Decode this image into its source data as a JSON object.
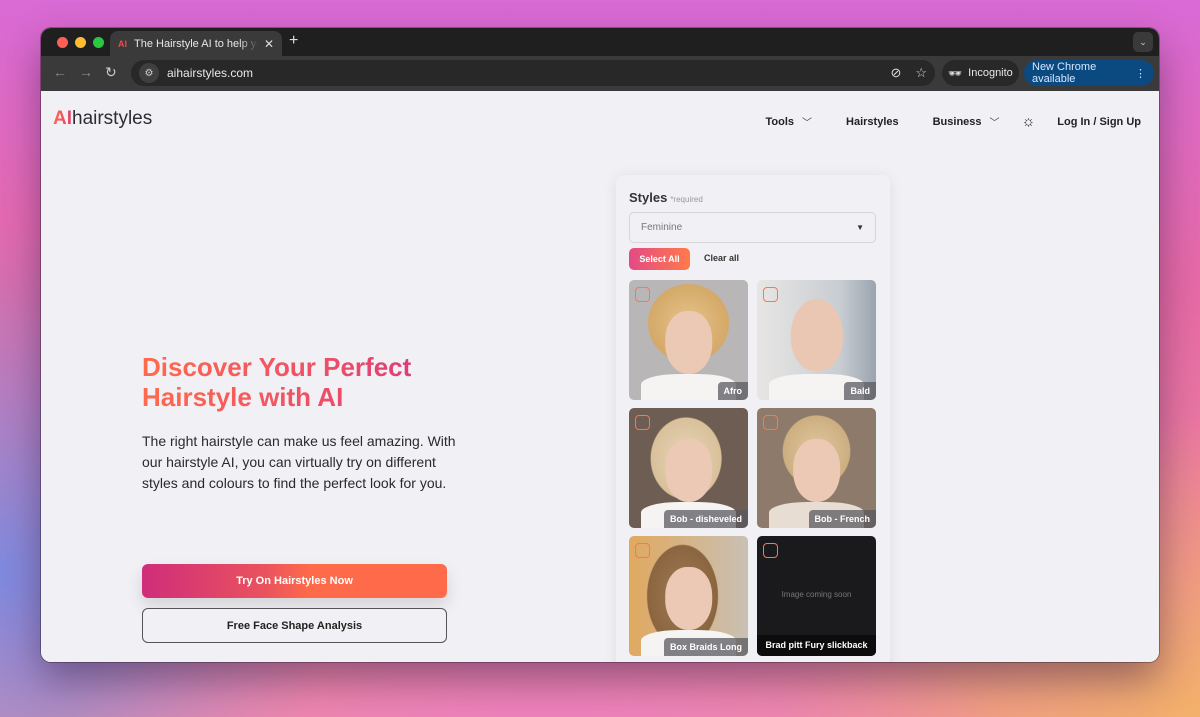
{
  "browser": {
    "tab_title": "The Hairstyle AI to help you find",
    "tab_favicon": "AI",
    "url": "aihairstyles.com",
    "incognito_label": "Incognito",
    "update_label": "New Chrome available"
  },
  "header": {
    "logo_ai": "AI",
    "logo_rest": "hairstyles",
    "nav": [
      {
        "label": "Tools",
        "has_dropdown": true
      },
      {
        "label": "Hairstyles",
        "has_dropdown": false
      },
      {
        "label": "Business",
        "has_dropdown": true
      }
    ],
    "login_label": "Log In / Sign Up"
  },
  "hero": {
    "title": "Discover Your Perfect Hairstyle with AI",
    "description": "The right hairstyle can make us feel amazing. With our hairstyle AI, you can virtually try on different styles and colours to find the perfect look for you.",
    "primary_cta": "Try On Hairstyles Now",
    "secondary_cta": "Free Face Shape Analysis"
  },
  "styles_panel": {
    "title": "Styles",
    "required_label": "*required",
    "select_value": "Feminine",
    "select_all_label": "Select All",
    "clear_all_label": "Clear all",
    "cards": [
      {
        "label": "Afro",
        "checked": false
      },
      {
        "label": "Bald",
        "checked": false
      },
      {
        "label": "Bob - disheveled",
        "checked": false
      },
      {
        "label": "Bob - French",
        "checked": false
      },
      {
        "label": "Box Braids Long",
        "checked": false
      },
      {
        "label": "Brad pitt Fury slickback",
        "checked": false,
        "placeholder_text": "Image coming soon"
      }
    ]
  },
  "colors": {
    "brand_orange": "#ff6a4a",
    "brand_pink": "#d02d7a",
    "chrome_update_blue": "#0b4a80"
  }
}
